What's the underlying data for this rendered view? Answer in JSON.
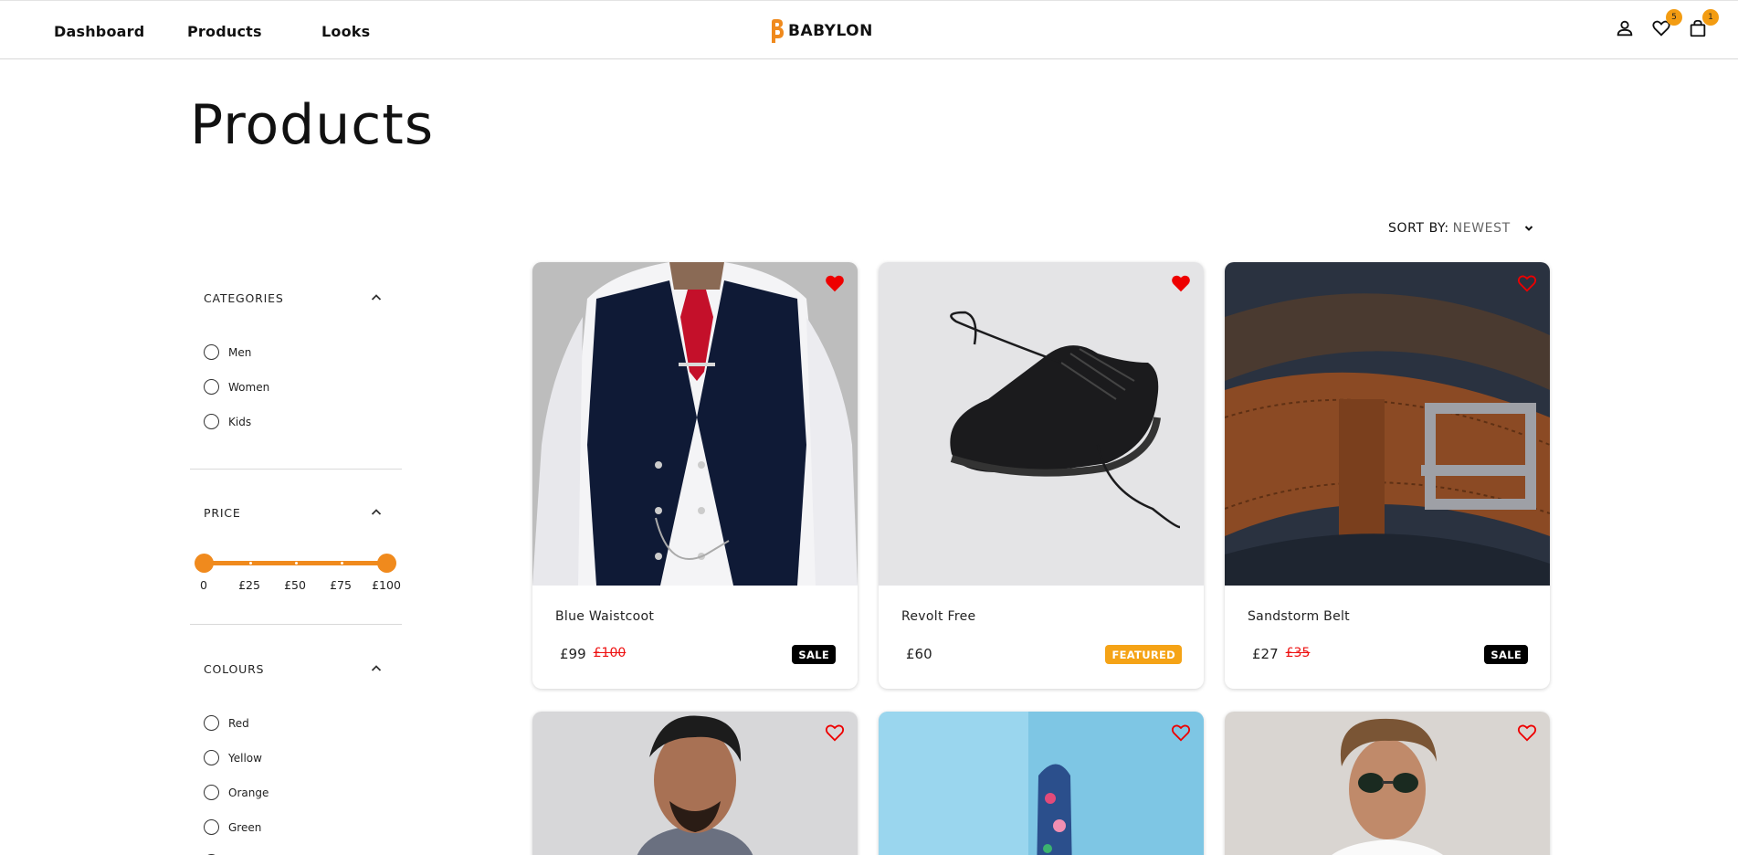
{
  "header": {
    "nav": [
      {
        "label": "Dashboard"
      },
      {
        "label": "Products"
      },
      {
        "label": "Looks"
      }
    ],
    "brand": "BABYLON",
    "wishlist_count": "5",
    "cart_count": "1",
    "icons": [
      "user-icon",
      "heart-icon",
      "shopping-bag-icon"
    ],
    "accent_color": "#f08a1d"
  },
  "page": {
    "title": "Products"
  },
  "sort": {
    "label": "SORT BY:",
    "value": "NEWEST"
  },
  "filters": {
    "categories": {
      "title": "CATEGORIES",
      "options": [
        "Men",
        "Women",
        "Kids"
      ]
    },
    "price": {
      "title": "PRICE",
      "ticks": [
        "0",
        "£25",
        "£50",
        "£75",
        "£100"
      ],
      "min_value": 0,
      "max_value": 100
    },
    "colours": {
      "title": "COLOURS",
      "options": [
        "Red",
        "Yellow",
        "Orange",
        "Green"
      ]
    }
  },
  "products": [
    {
      "name": "Blue Waistcoot",
      "price": "£99",
      "old_price": "£100",
      "tag": "SALE",
      "favorite": true
    },
    {
      "name": "Revolt Free",
      "price": "£60",
      "old_price": "",
      "tag": "FEATURED",
      "favorite": true
    },
    {
      "name": "Sandstorm Belt",
      "price": "£27",
      "old_price": "£35",
      "tag": "SALE",
      "favorite": false
    },
    {
      "name": "",
      "price": "",
      "old_price": "",
      "tag": "",
      "favorite": false
    },
    {
      "name": "",
      "price": "",
      "old_price": "",
      "tag": "",
      "favorite": false
    },
    {
      "name": "",
      "price": "",
      "old_price": "",
      "tag": "",
      "favorite": false
    }
  ]
}
